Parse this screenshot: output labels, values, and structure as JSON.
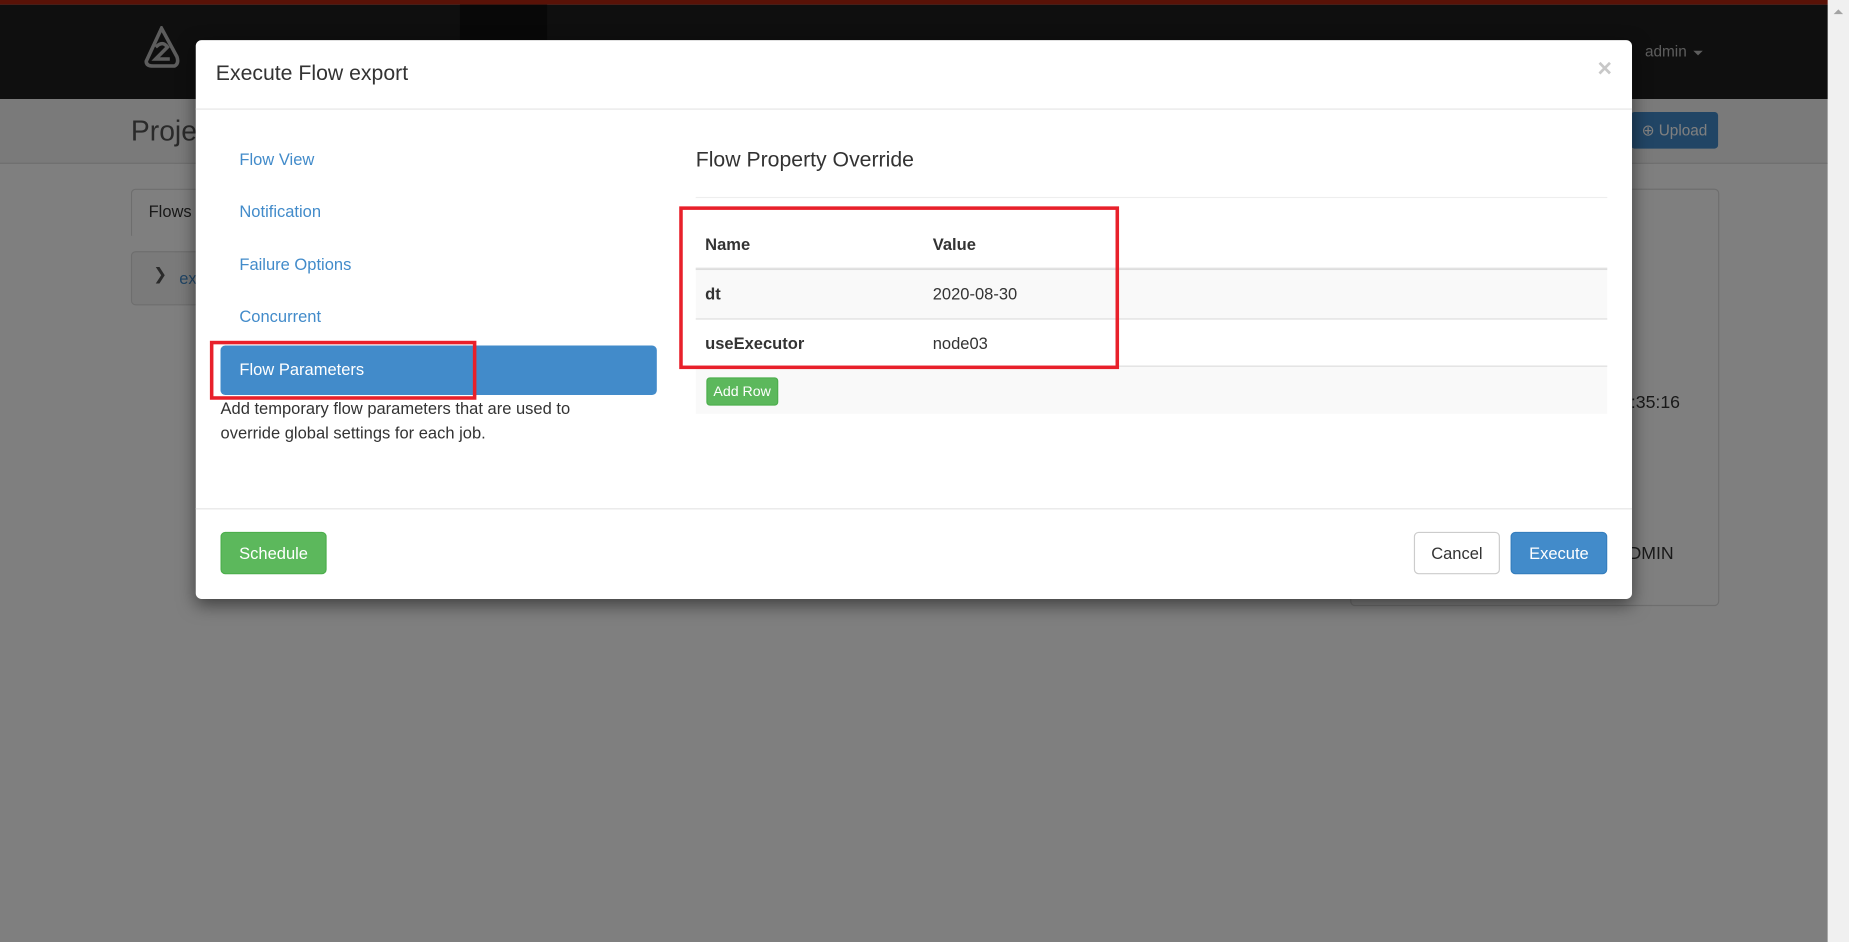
{
  "background": {
    "user_menu": "admin",
    "page_title_partial": "Proje",
    "upload_button": "Upload",
    "flows_tab_partial": "Flows",
    "flow_row_partial": "ex",
    "time_partial": ":35:16",
    "user_partial": "DMIN"
  },
  "modal": {
    "title": "Execute Flow export",
    "close_icon": "close-icon",
    "nav": [
      {
        "label": "Flow View"
      },
      {
        "label": "Notification"
      },
      {
        "label": "Failure Options"
      },
      {
        "label": "Concurrent"
      },
      {
        "label": "Flow Parameters",
        "active": true
      }
    ],
    "help_text": "Add temporary flow parameters that are used to override global settings for each job.",
    "section_title": "Flow Property Override",
    "table": {
      "headers": [
        "Name",
        "Value"
      ],
      "rows": [
        {
          "name": "dt",
          "value": "2020-08-30"
        },
        {
          "name": "useExecutor",
          "value": "node03"
        }
      ]
    },
    "add_row_button": "Add Row",
    "schedule_button": "Schedule",
    "cancel_button": "Cancel",
    "execute_button": "Execute"
  },
  "colors": {
    "primary": "#428bca",
    "success": "#5cb85c",
    "highlight": "#e8202a",
    "navbar": "#1f1f1f",
    "top_accent": "#b2240f"
  }
}
